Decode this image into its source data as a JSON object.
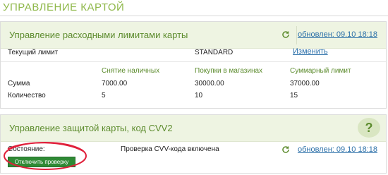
{
  "page": {
    "title": "УПРАВЛЕНИЕ КАРТОЙ"
  },
  "limits": {
    "title": "Управление расходными лимитами карты",
    "updated": "обновлен: 09.10 18:18",
    "current_limit_label": "Текущий лимит",
    "current_limit_value": "STANDARD",
    "change_link": "Изменить",
    "columns": [
      "Снятие наличных",
      "Покупки в магазинах",
      "Суммарный лимит"
    ],
    "rows": [
      {
        "label": "Сумма",
        "values": [
          "7000.00",
          "30000.00",
          "37000.00"
        ]
      },
      {
        "label": "Количество",
        "values": [
          "5",
          "10",
          "15"
        ]
      }
    ]
  },
  "cvv": {
    "title": "Управление защитой карты, код CVV2",
    "help": "?",
    "state_label": "Состояние:",
    "state_value": "Проверка CVV-кода включена",
    "updated": "обновлен: 09.10 18:18",
    "disable_button": "Отключить проверку"
  },
  "icons": {
    "refresh": "refresh-icon",
    "help": "help-icon"
  },
  "colors": {
    "accent_green": "#5d8c2e",
    "link_blue": "#2a6fa8",
    "button_green": "#2f8a35",
    "annotation_red": "#e0203a"
  }
}
